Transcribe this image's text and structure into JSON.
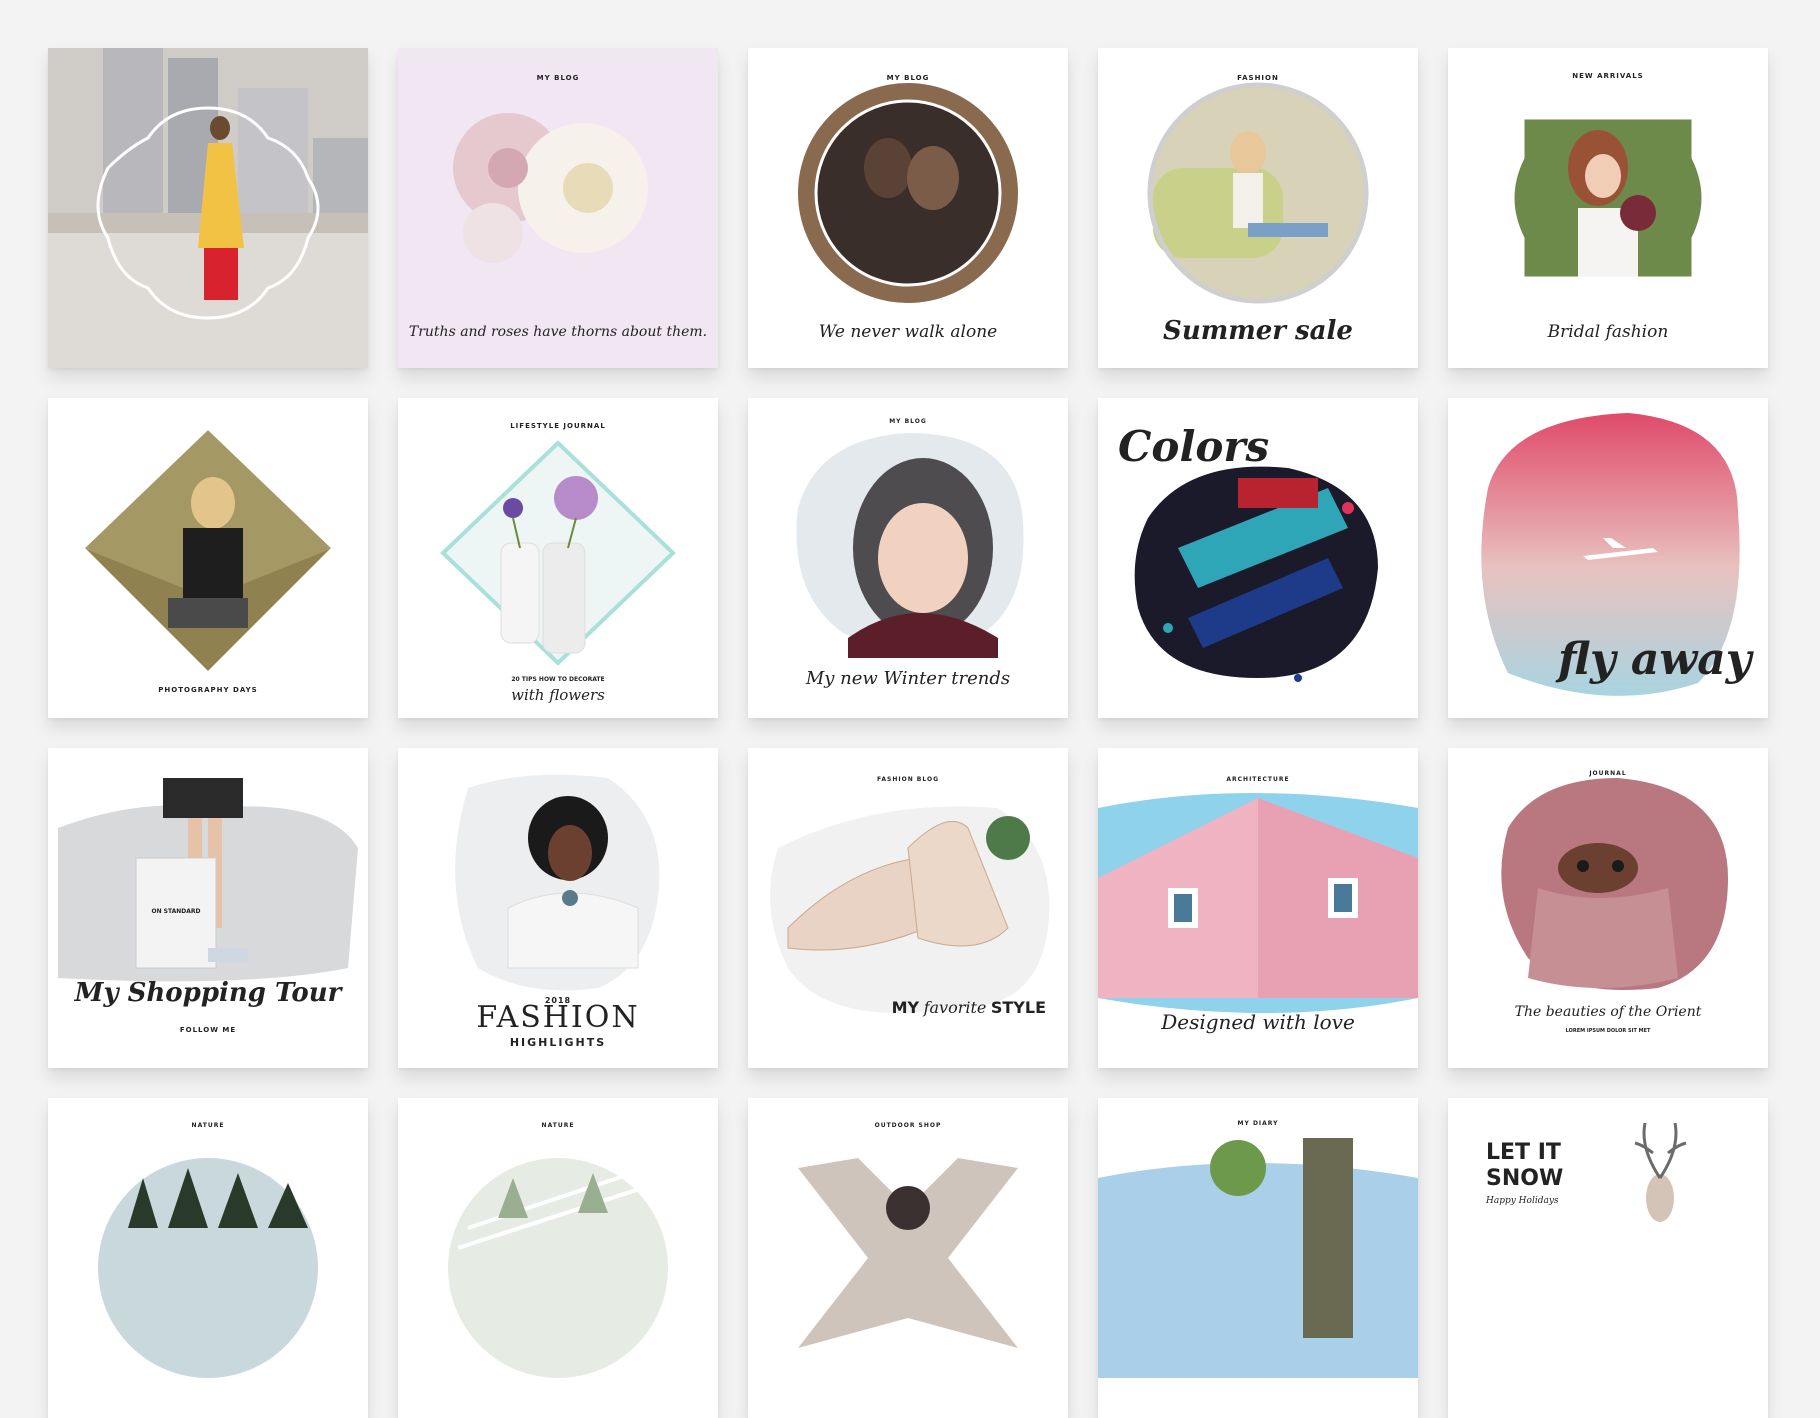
{
  "cards": {
    "c1": {},
    "c2": {
      "top": "MY BLOG",
      "caption": "Truths and roses have thorns about them."
    },
    "c3": {
      "top": "MY BLOG",
      "caption": "We never walk alone"
    },
    "c4": {
      "top": "FASHION",
      "caption": "Summer sale"
    },
    "c5": {
      "top": "NEW ARRIVALS",
      "caption": "Bridal fashion"
    },
    "c6": {
      "bottom": "PHOTOGRAPHY DAYS"
    },
    "c7": {
      "top": "LIFESTYLE JOURNAL",
      "small": "20 TIPS HOW TO DECORATE",
      "caption": "with flowers"
    },
    "c8": {
      "top": "MY BLOG",
      "caption": "My new Winter trends"
    },
    "c9": {
      "caption": "Colors"
    },
    "c10": {
      "caption": "fly away"
    },
    "c11": {
      "caption": "My Shopping Tour",
      "bottom": "FOLLOW ME",
      "bag_text": "ON STANDARD"
    },
    "c12": {
      "year": "2018",
      "title": "FASHION",
      "subtitle": "HIGHLIGHTS"
    },
    "c13": {
      "top": "FASHION BLOG",
      "caption_a": "MY",
      "caption_b": "favorite",
      "caption_c": "STYLE"
    },
    "c14": {
      "top": "ARCHITECTURE",
      "caption": "Designed with love"
    },
    "c15": {
      "top": "JOURNAL",
      "caption": "The beauties of the Orient",
      "small": "LOREM IPSUM DOLOR SIT MET"
    },
    "c16": {
      "top": "NATURE"
    },
    "c17": {
      "top": "NATURE"
    },
    "c18": {
      "top": "OUTDOOR SHOP"
    },
    "c19": {
      "top": "MY DIARY"
    },
    "c20": {
      "line1": "LET IT",
      "line2": "SNOW",
      "small": "Happy Holidays"
    }
  },
  "colors": {
    "background": "#f3f3f3",
    "card": "#ffffff",
    "pink_tint": "#f1e7f3",
    "text": "#222222"
  }
}
